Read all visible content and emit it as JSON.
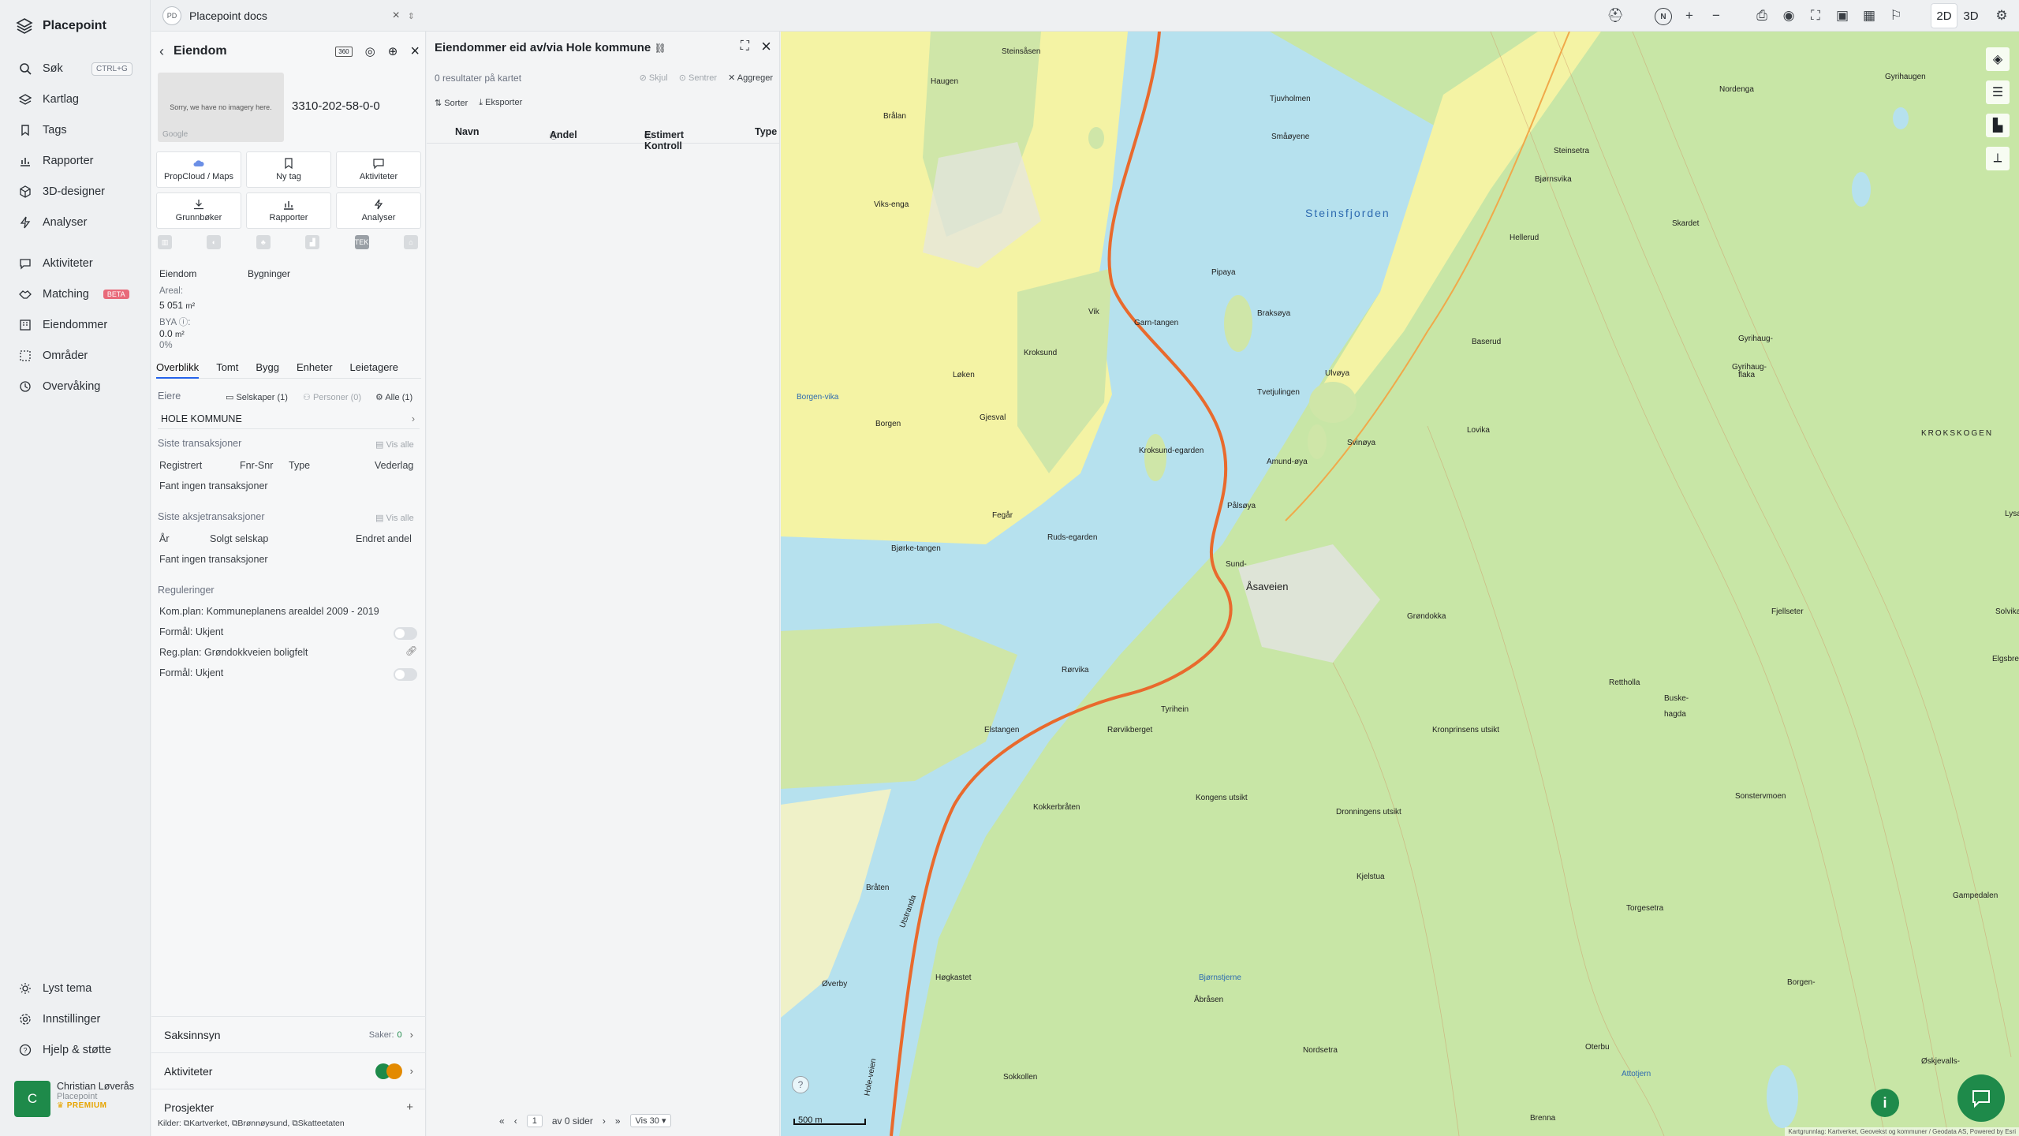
{
  "app": {
    "brand": "Placepoint"
  },
  "nav": {
    "search": {
      "label": "Søk",
      "shortcut": "CTRL+G"
    },
    "items": [
      "Kartlag",
      "Tags",
      "Rapporter",
      "3D-designer",
      "Analyser"
    ],
    "items2": [
      "Aktiviteter",
      "Matching",
      "Eiendommer",
      "Områder",
      "Overvåking"
    ],
    "beta": "BETA",
    "bottom": [
      "Lyst tema",
      "Innstillinger",
      "Hjelp & støtte"
    ],
    "user": {
      "initial": "C",
      "name": "Christian Løverås",
      "org": "Placepoint",
      "plan": "PREMIUM"
    }
  },
  "topbar": {
    "workspace_badge": "PD",
    "workspace_name": "Placepoint docs",
    "dim_2d": "2D",
    "dim_3d": "3D",
    "compass": "N"
  },
  "property": {
    "title": "Eiendom",
    "no_imagery": "Sorry, we have no imagery here.",
    "google": "Google",
    "id": "3310-202-58-0-0",
    "actions": [
      "PropCloud / Maps",
      "Ny tag",
      "Aktiviteter",
      "Grunnbøker",
      "Rapporter",
      "Analyser"
    ],
    "mini_tek": "TEK",
    "kind_labels": [
      "Eiendom",
      "Bygninger"
    ],
    "areal_label": "Areal:",
    "areal_value": "5 051",
    "areal_unit": "m²",
    "bya_label": "BYA",
    "bya_value": "0.0",
    "bya_unit": "m²",
    "bya_pct": "0%",
    "tabs": [
      "Overblikk",
      "Tomt",
      "Bygg",
      "Enheter",
      "Leietagere"
    ],
    "owners_label": "Eiere",
    "owners_filters": [
      "Selskaper (1)",
      "Personer (0)",
      "Alle (1)"
    ],
    "owner": "HOLE KOMMUNE",
    "transactions_label": "Siste transaksjoner",
    "see_all": "Vis alle",
    "tx_cols": [
      "Registrert",
      "Fnr-Snr",
      "Type",
      "Vederlag"
    ],
    "tx_empty": "Fant ingen transaksjoner",
    "share_tx_label": "Siste aksjetransaksjoner",
    "share_cols": [
      "År",
      "Solgt selskap",
      "Endret andel"
    ],
    "share_empty": "Fant ingen transaksjoner",
    "regulations_label": "Reguleringer",
    "reg_komplan": "Kom.plan: Kommuneplanens arealdel 2009 - 2019",
    "reg_formal1": "Formål: Ukjent",
    "reg_plan": "Reg.plan: Grøndokkveien boligfelt",
    "reg_formal2": "Formål: Ukjent",
    "saksinnsyn": "Saksinnsyn",
    "saker_label": "Saker:",
    "saker_count": "0",
    "aktiviteter": "Aktiviteter",
    "prosjekter": "Prosjekter",
    "sources_label": "Kilder:",
    "sources": [
      "Kartverket",
      "Brønnøysund",
      "Skatteetaten"
    ]
  },
  "list": {
    "title": "Eiendommer eid av/via Hole kommune",
    "results": "0 resultater på kartet",
    "tools": [
      "Skjul",
      "Sentrer",
      "Aggreger"
    ],
    "actions": [
      "Sorter",
      "Eksporter"
    ],
    "columns": [
      "Navn",
      "Andel",
      "Estimert Kontroll",
      "Type"
    ],
    "pager": {
      "page": "1",
      "of_pages": "av 0 sider",
      "per_page": "Vis 30"
    }
  },
  "map": {
    "scale": "500 m",
    "attribution": "Kartgrunnlag: Kartverket, Geovekst og kommuner / Geodata AS, Powered by Esri",
    "labels": [
      "Steinsåsen",
      "Haugen",
      "Brålan",
      "Kroksund",
      "Steinsfjorden",
      "Tjuvholmen",
      "Småøyene",
      "Pipaya",
      "Braksøya",
      "Garn-tangen",
      "Vik",
      "Borgen-vika",
      "Borgen",
      "Løken",
      "Gjesval",
      "Tvetjulingen",
      "Ulvøya",
      "Svinøya",
      "Amund-øya",
      "Pålsøya",
      "Viks-enga",
      "Kroksund-egarden",
      "Bjørke-tangen",
      "Fegår",
      "Ruds-egarden",
      "Sund-",
      "Åsaveien",
      "Grøndokka",
      "Rørvika",
      "Elstangen",
      "Tyrihein",
      "Rørvikberget",
      "Kongens utsikt",
      "Kokkerbråten",
      "Bråten",
      "Utstranda",
      "Høgkastet",
      "Øverby",
      "Hole-veien",
      "Åbråsen",
      "Sokkollen",
      "Nordsetra",
      "Bjørnstjerne",
      "Gyrihaug-",
      "flaka",
      "KROKSKOGEN",
      "Baserud",
      "Lysaker",
      "Lovika",
      "Bjørnsvika",
      "Hellerud",
      "Skardet",
      "Fjellseter",
      "Rettholla",
      "Buske-",
      "hagda",
      "Gyrihaugen",
      "Nordenga",
      "Steinsetra",
      "Solvika",
      "Gyrihaug-",
      "Torgesetra",
      "Borgen-",
      "Gampedalen",
      "Øskjevalls-",
      "Elgsbrenn",
      "Brenna",
      "Oterbu",
      "Attotjern",
      "Sonstervmoen",
      "Kronprinsens utsikt",
      "Dronningens utsikt",
      "Kjelstua"
    ]
  }
}
